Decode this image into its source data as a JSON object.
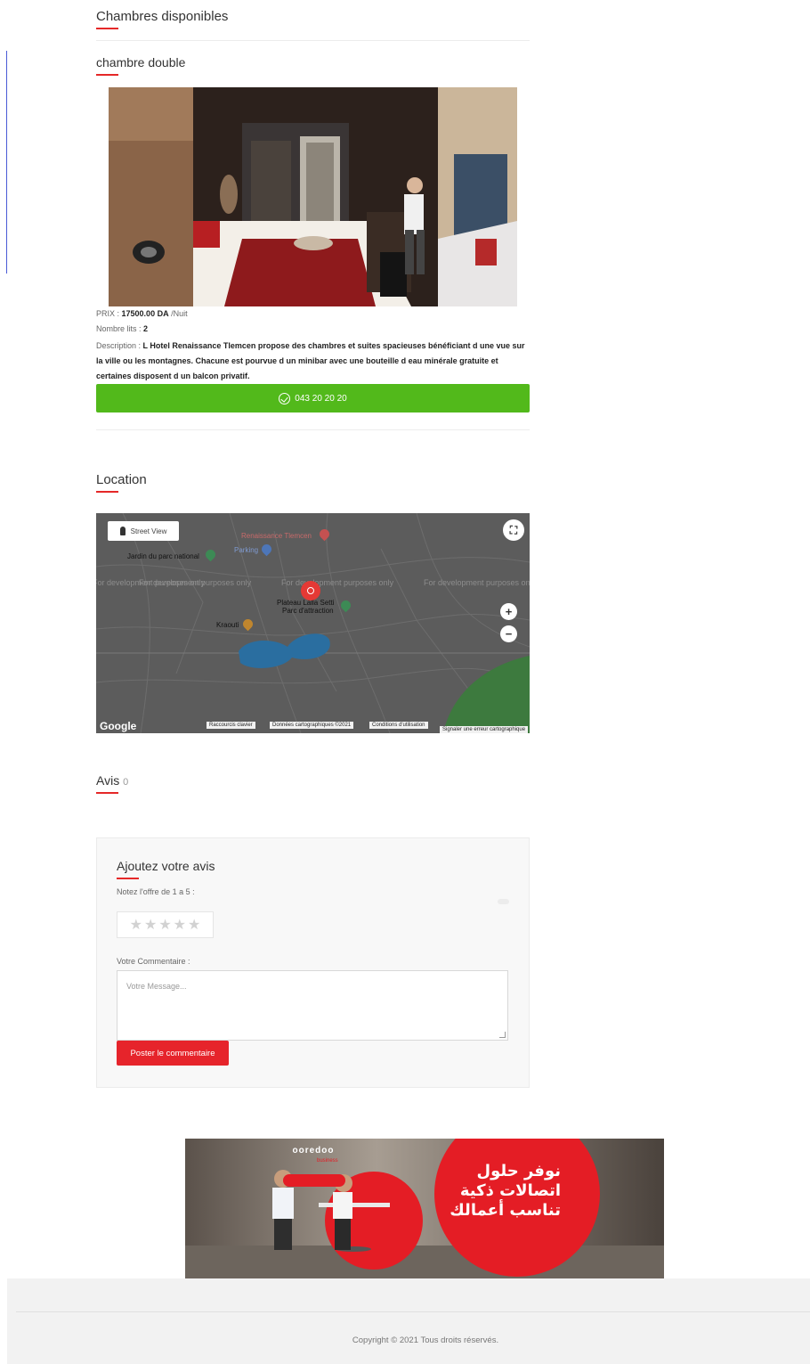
{
  "rooms_section": {
    "title": "Chambres disponibles"
  },
  "room": {
    "name": "chambre double",
    "price_label": "PRIX :",
    "price_value": "17500.00 DA",
    "price_unit": "/Nuit",
    "beds_label": "Nombre lits :",
    "beds_value": "2",
    "description_label": "Description :",
    "description": "L Hotel Renaissance Tlemcen propose des chambres et suites spacieuses bénéficiant d une vue sur la ville ou les montagnes. Chacune est pourvue d un minibar avec une bouteille d eau minérale gratuite et certaines disposent d un balcon privatif.",
    "phone": "043 20 20 20"
  },
  "location": {
    "title": "Location",
    "street_view": "Street View",
    "dev_text": "For development purposes only",
    "pois": [
      "Renaissance Tlemcen",
      "Parking",
      "Jardin du parc national",
      "Plateau Lalla Setti",
      "Parc d'attraction",
      "Kraouti"
    ],
    "zoom_in": "+",
    "zoom_out": "−",
    "google": "Google",
    "shortcuts": "Raccourcis clavier",
    "map_data": "Données cartographiques ©2021",
    "terms": "Conditions d'utilisation",
    "report": "Signaler une erreur cartographique"
  },
  "reviews": {
    "title": "Avis",
    "count": "0"
  },
  "review_form": {
    "title": "Ajoutez votre avis",
    "rating_label": "Notez l'offre de 1 a 5 :",
    "comment_label": "Votre Commentaire :",
    "comment_placeholder": "Votre Message...",
    "submit": "Poster le commentaire"
  },
  "banner": {
    "brand": "ooredoo",
    "brand_sub": "business",
    "line1": "نوفر حلول",
    "line2": "اتصالات ذكية",
    "line3": "تناسب أعمالك"
  },
  "footer": {
    "copyright": "Copyright © 2021 Tous droits réservés."
  },
  "colors": {
    "accent_red": "#e52828",
    "green": "#52b91b",
    "button_red": "#e6242b"
  }
}
